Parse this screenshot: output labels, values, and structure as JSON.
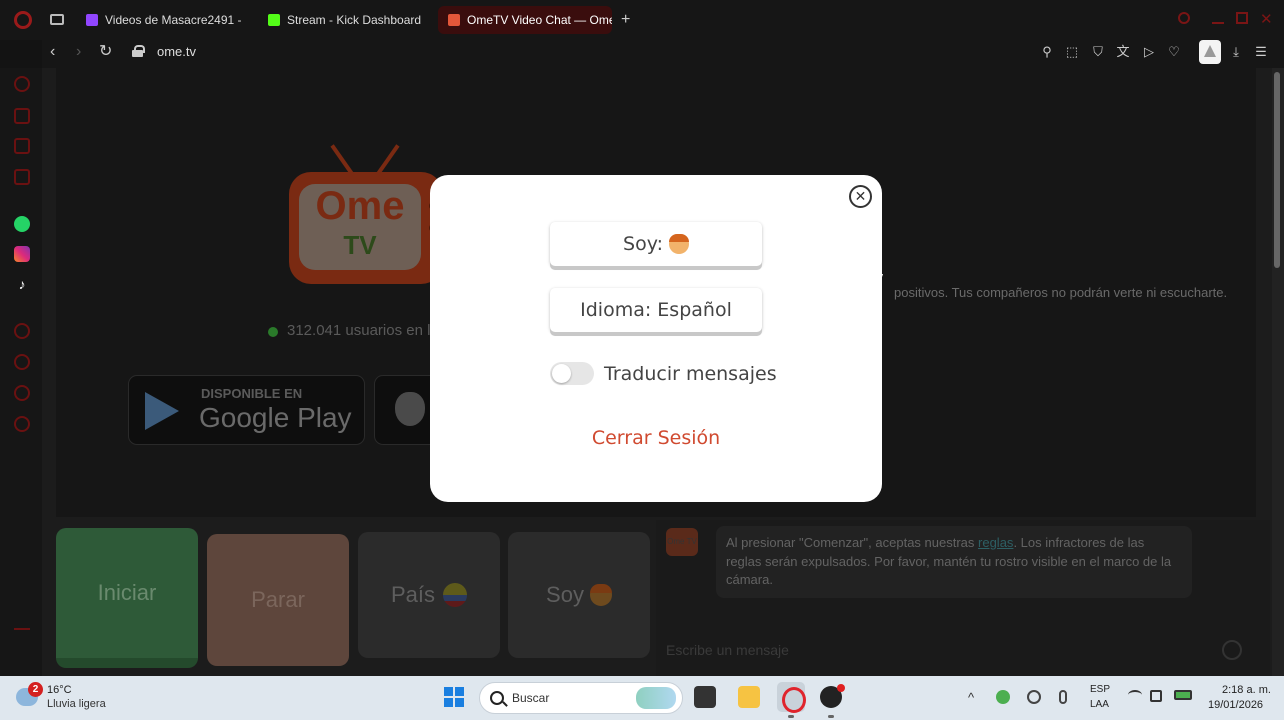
{
  "browser": {
    "tabs": [
      {
        "title": "Videos de Masacre2491 -"
      },
      {
        "title": "Stream - Kick Dashboard"
      },
      {
        "title": "OmeTV Video Chat — Ome"
      }
    ],
    "new_tab_label": "+",
    "url": "ome.tv",
    "win_close_glyph": "✕",
    "nav": {
      "back": "‹",
      "forward": "›",
      "reload": "↻"
    }
  },
  "hero": {
    "logo_text_top": "Ome",
    "logo_text_bottom": "TV",
    "users_online": "312.041 usuarios en l",
    "notice_text": "positivos. Tus compañeros no podrán verte ni escucharte.",
    "google_play_small": "DISPONIBLE EN",
    "google_play_big": "Google Play"
  },
  "controls": {
    "start_label": "Iniciar",
    "stop_label": "Parar",
    "country_label": "País",
    "soy_label": "Soy"
  },
  "chat": {
    "avatar_text": "Ome TV",
    "message_before_link": "Al presionar \"Comenzar\", aceptas nuestras ",
    "message_link": "reglas",
    "message_after_link": ". Los infractores de las reglas serán expulsados. Por favor, mantén tu rostro visible en el marco de la cámara.",
    "input_placeholder": "Escribe un mensaje"
  },
  "modal": {
    "close_glyph": "✕",
    "soy_button_label": "Soy:",
    "language_button_label": "Idioma: Español",
    "translate_label": "Traducir mensajes",
    "translate_enabled": false,
    "logout_label": "Cerrar Sesión"
  },
  "taskbar": {
    "weather_badge": "2",
    "temperature": "16°C",
    "weather_desc": "Lluvia ligera",
    "search_placeholder": "Buscar",
    "tray_chevron": "^",
    "language_top": "ESP",
    "language_bottom": "LAA",
    "time": "2:18 a. m.",
    "date": "19/01/2026"
  },
  "colors": {
    "accent_opera": "#e0242c",
    "ome_orange": "#e3573a",
    "logout_red": "#d04a30",
    "modal_bg": "#ffffff"
  }
}
